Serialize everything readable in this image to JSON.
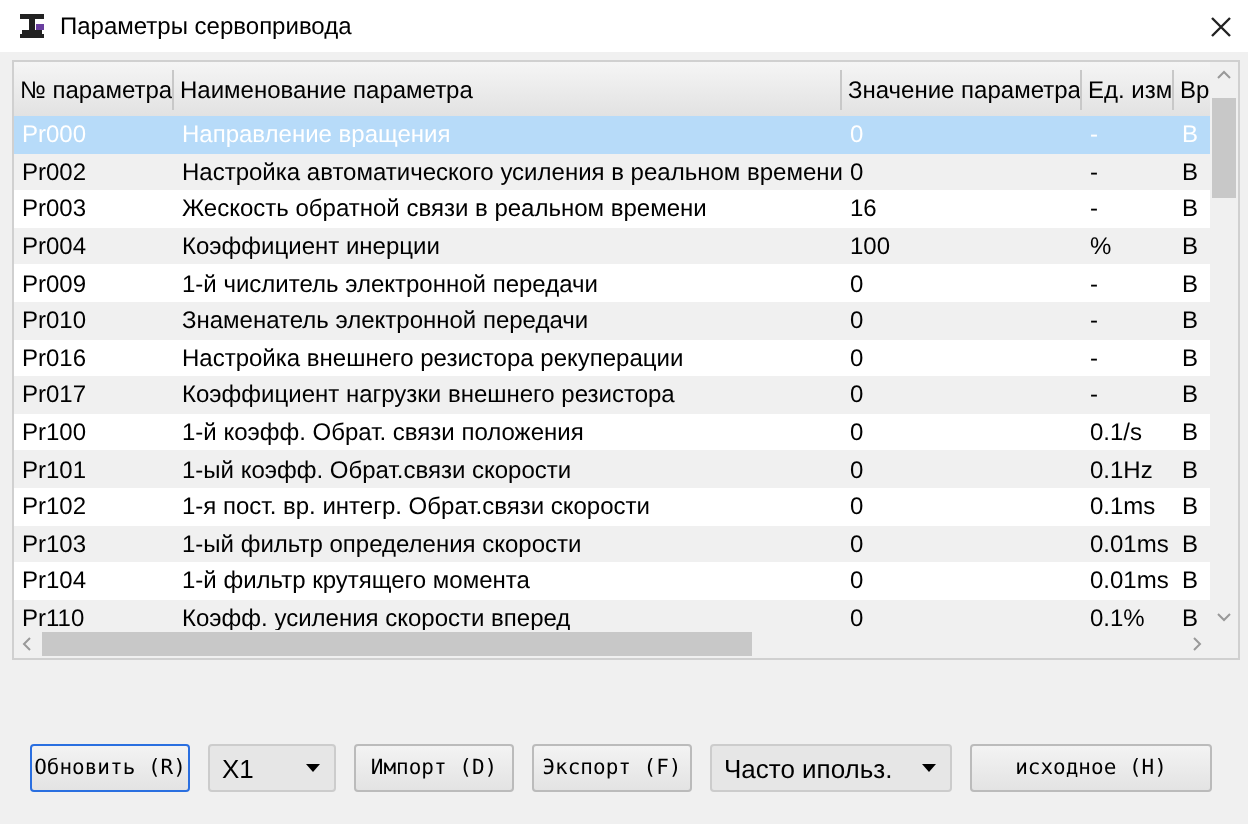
{
  "window": {
    "title": "Параметры сервопривода"
  },
  "table": {
    "columns": [
      "№ параметра",
      "Наименование параметра",
      "Значение параметра",
      "Ед. изм",
      "Вр"
    ],
    "rows": [
      {
        "cells": [
          "Pr000",
          "Направление вращения",
          "0",
          "-",
          "В"
        ],
        "selected": true
      },
      {
        "cells": [
          "Pr002",
          "Настройка автоматического усиления в реальном времени",
          "0",
          "-",
          "В"
        ],
        "selected": false
      },
      {
        "cells": [
          "Pr003",
          "Жескость обратной связи в реальном времени",
          "16",
          "-",
          "В"
        ],
        "selected": false
      },
      {
        "cells": [
          "Pr004",
          "Коэффициент инерции",
          "100",
          "%",
          "В"
        ],
        "selected": false
      },
      {
        "cells": [
          "Pr009",
          "1-й числитель электронной передачи",
          "0",
          "-",
          "В"
        ],
        "selected": false
      },
      {
        "cells": [
          "Pr010",
          "Знаменатель электронной передачи",
          "0",
          "-",
          "В"
        ],
        "selected": false
      },
      {
        "cells": [
          "Pr016",
          "Настройка внешнего резистора рекуперации",
          "0",
          "-",
          "В"
        ],
        "selected": false
      },
      {
        "cells": [
          "Pr017",
          "Коэффициент нагрузки внешнего резистора",
          "0",
          "-",
          "В"
        ],
        "selected": false
      },
      {
        "cells": [
          "Pr100",
          "1-й коэфф. Обрат. связи положения",
          "0",
          "0.1/s",
          "В"
        ],
        "selected": false
      },
      {
        "cells": [
          "Pr101",
          "1-ый коэфф. Обрат.связи  скорости",
          "0",
          "0.1Hz",
          "В"
        ],
        "selected": false
      },
      {
        "cells": [
          "Pr102",
          "1-я пост. вр. интегр. Обрат.связи  скорости",
          "0",
          "0.1ms",
          "В"
        ],
        "selected": false
      },
      {
        "cells": [
          "Pr103",
          "1-ый фильтр определения скорости",
          "0",
          "0.01ms",
          "В"
        ],
        "selected": false
      },
      {
        "cells": [
          "Pr104",
          "1-й фильтр крутящего момента",
          "0",
          "0.01ms",
          "В"
        ],
        "selected": false
      },
      {
        "cells": [
          "Pr110",
          "Коэфф. усиления  скорости вперед",
          "0",
          "0.1%",
          "В"
        ],
        "selected": false
      }
    ]
  },
  "toolbar": [
    {
      "kind": "button",
      "label": "Обновить (R)",
      "focused": true
    },
    {
      "kind": "dropdown",
      "value": "X1"
    },
    {
      "kind": "button",
      "label": "Импорт (D)",
      "focused": false
    },
    {
      "kind": "button",
      "label": "Экспорт (F)",
      "focused": false
    },
    {
      "kind": "dropdown",
      "value": "Часто ипольз."
    },
    {
      "kind": "button",
      "label": "исходное (H)",
      "focused": false
    }
  ]
}
